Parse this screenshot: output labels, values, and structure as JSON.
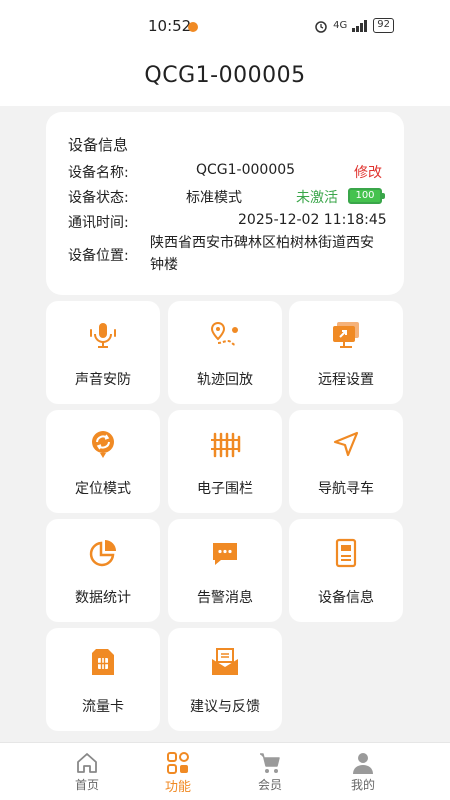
{
  "status_bar": {
    "time": "10:52",
    "signal": "4G",
    "battery": "92"
  },
  "header": {
    "title": "QCG1-000005"
  },
  "device_info": {
    "heading": "设备信息",
    "name_label": "设备名称:",
    "name_value": "QCG1-000005",
    "edit": "修改",
    "status_label": "设备状态:",
    "status_value": "标准模式",
    "activation": "未激活",
    "battery_level": "100",
    "time_label": "通讯时间:",
    "time_value": "2025-12-02 11:18:45",
    "location_label": "设备位置:",
    "location_value": "陕西省西安市碑林区柏树林街道西安钟楼"
  },
  "tiles": [
    {
      "label": "声音安防",
      "icon": "microphone-icon"
    },
    {
      "label": "轨迹回放",
      "icon": "route-icon"
    },
    {
      "label": "远程设置",
      "icon": "remote-screen-icon"
    },
    {
      "label": "定位模式",
      "icon": "location-sync-icon"
    },
    {
      "label": "电子围栏",
      "icon": "fence-icon"
    },
    {
      "label": "导航寻车",
      "icon": "navigation-icon"
    },
    {
      "label": "数据统计",
      "icon": "pie-chart-icon"
    },
    {
      "label": "告警消息",
      "icon": "message-icon"
    },
    {
      "label": "设备信息",
      "icon": "device-icon"
    },
    {
      "label": "流量卡",
      "icon": "sim-card-icon"
    },
    {
      "label": "建议与反馈",
      "icon": "mail-icon"
    }
  ],
  "nav": [
    {
      "label": "首页",
      "icon": "home-icon"
    },
    {
      "label": "功能",
      "icon": "grid-icon"
    },
    {
      "label": "会员",
      "icon": "cart-icon"
    },
    {
      "label": "我的",
      "icon": "user-icon"
    }
  ],
  "colors": {
    "accent": "#f08a24",
    "danger": "#e0342f",
    "success": "#3aa64a"
  }
}
